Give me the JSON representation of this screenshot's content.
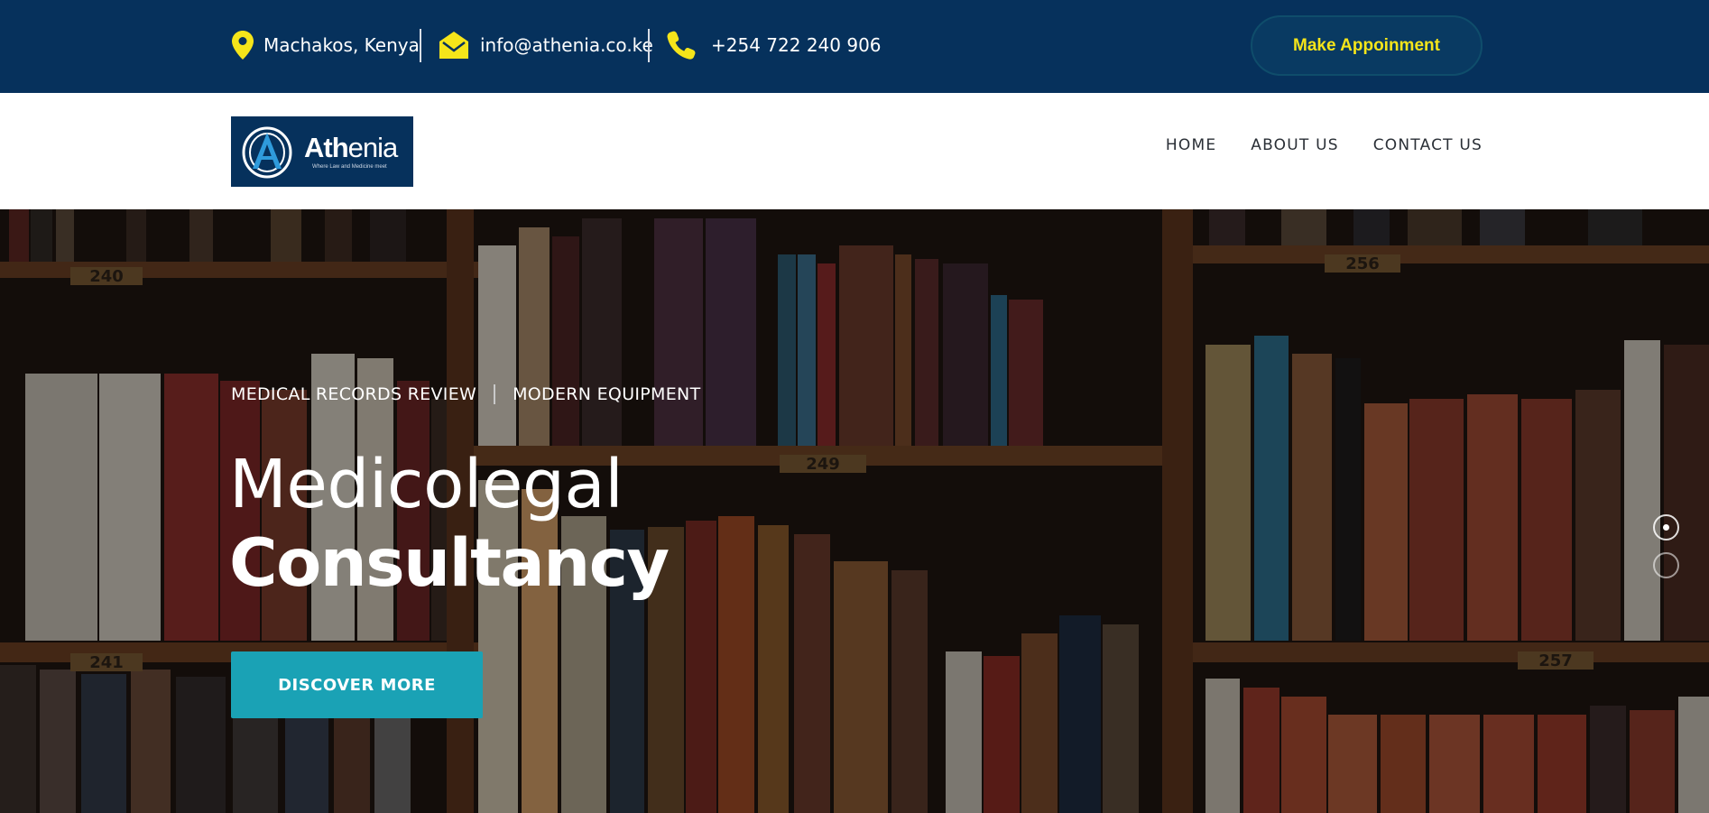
{
  "topbar": {
    "location": {
      "icon": "map-pin-icon",
      "text": "Machakos, Kenya"
    },
    "email": {
      "icon": "envelope-icon",
      "text": "info@athenia.co.ke"
    },
    "phone": {
      "icon": "phone-icon",
      "text": "+254 722 240 906"
    },
    "appointment_label": "Make Appoinment",
    "colors": {
      "background": "#06315c",
      "accent": "#f5e51a"
    }
  },
  "header": {
    "logo": {
      "word_bold": "Ath",
      "word_light": "enia",
      "tagline": "Where Law and Medicine meet"
    },
    "nav": {
      "home": "HOME",
      "about": "ABOUT US",
      "contact": "CONTACT US"
    }
  },
  "hero": {
    "tag_1": "MEDICAL RECORDS REVIEW",
    "tag_2": "MODERN EQUIPMENT",
    "title_light": "Medicolegal",
    "title_bold": "Consultancy",
    "cta_label": "DISCOVER MORE",
    "shelf_labels": [
      "240",
      "249",
      "256",
      "241",
      "257"
    ],
    "slides": {
      "count": 2,
      "active": 1
    },
    "colors": {
      "cta": "#1aa2b5"
    }
  }
}
